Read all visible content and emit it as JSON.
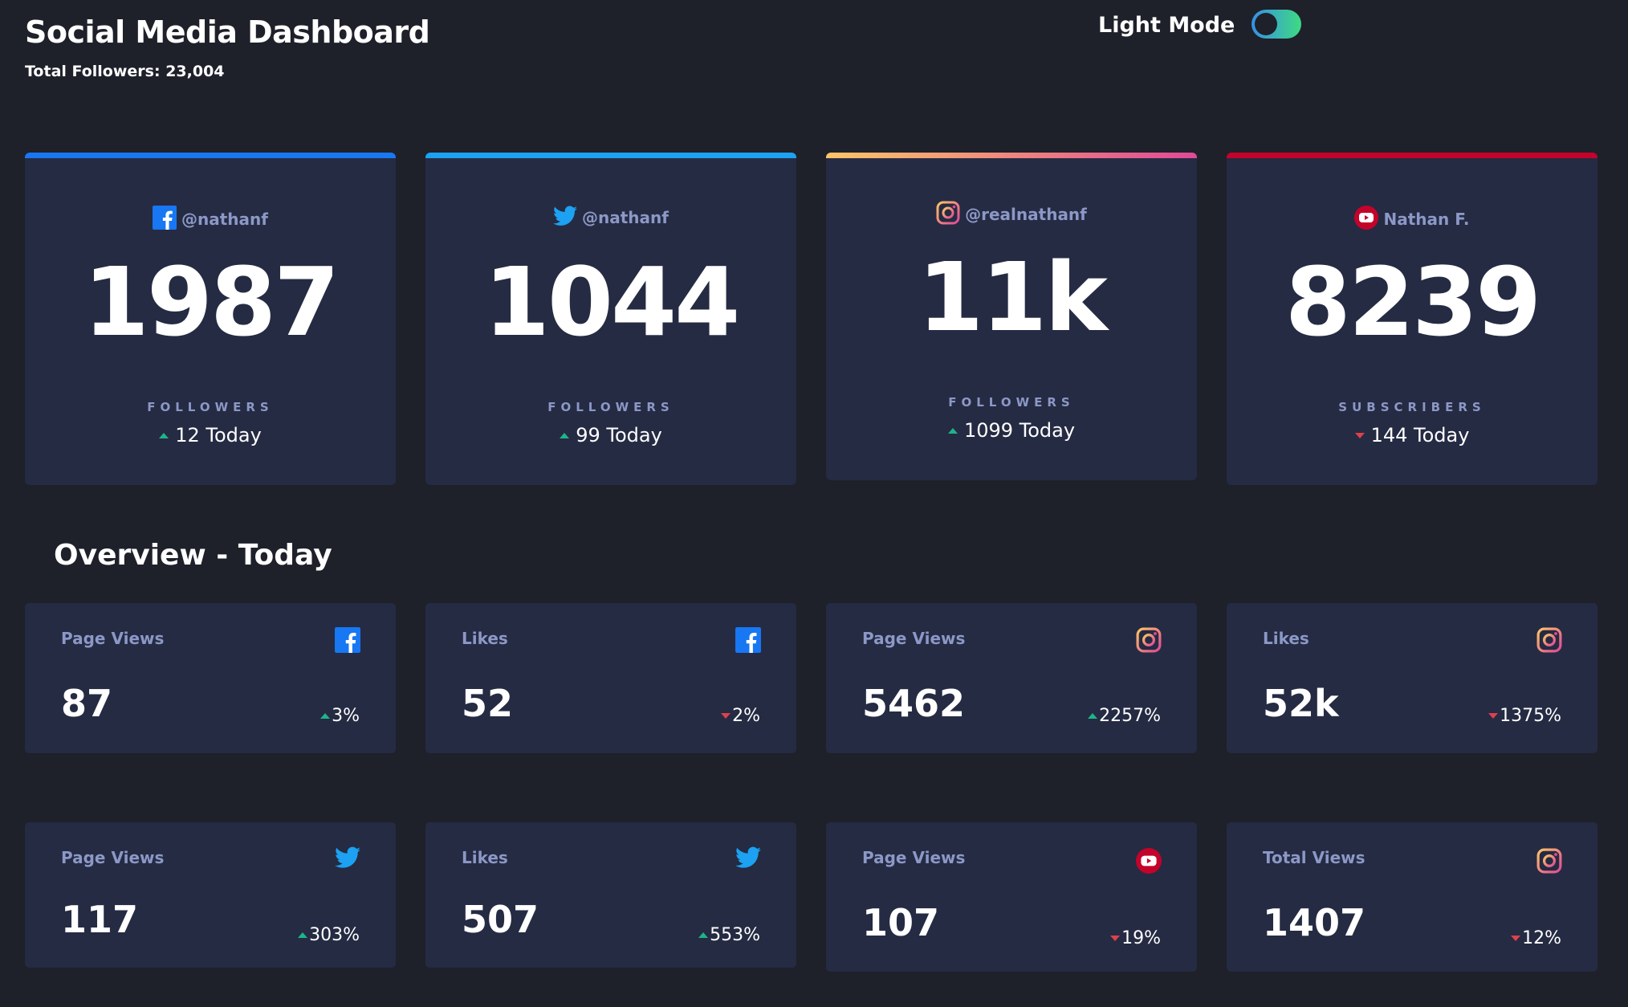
{
  "header": {
    "title": "Social Media Dashboard",
    "total_followers": "Total Followers: 23,004",
    "mode_label": "Light Mode"
  },
  "colors": {
    "facebook": "#1877f2",
    "twitter": "#1da1f2",
    "instagram_start": "#fdc468",
    "instagram_end": "#df4996",
    "youtube": "#c4032a",
    "up": "#1db489",
    "down": "#dc414c",
    "card_bg": "#252b43",
    "page_bg": "#1e202a"
  },
  "followers": [
    {
      "platform": "facebook",
      "icon": "facebook-icon",
      "handle": "@nathanf",
      "count": "1987",
      "unit": "FOLLOWERS",
      "today": "12 Today",
      "trend": "up"
    },
    {
      "platform": "twitter",
      "icon": "twitter-icon",
      "handle": "@nathanf",
      "count": "1044",
      "unit": "FOLLOWERS",
      "today": "99 Today",
      "trend": "up"
    },
    {
      "platform": "instagram",
      "icon": "instagram-icon",
      "handle": "@realnathanf",
      "count": "11k",
      "unit": "FOLLOWERS",
      "today": "1099 Today",
      "trend": "up"
    },
    {
      "platform": "youtube",
      "icon": "youtube-icon",
      "handle": "Nathan F.",
      "count": "8239",
      "unit": "SUBSCRIBERS",
      "today": "144 Today",
      "trend": "down"
    }
  ],
  "overview": {
    "title": "Overview - Today",
    "cards": [
      {
        "label": "Page Views",
        "icon": "facebook-icon",
        "value": "87",
        "pct": "3%",
        "trend": "up"
      },
      {
        "label": "Likes",
        "icon": "facebook-icon",
        "value": "52",
        "pct": "2%",
        "trend": "down"
      },
      {
        "label": "Page Views",
        "icon": "instagram-icon",
        "value": "5462",
        "pct": "2257%",
        "trend": "up"
      },
      {
        "label": "Likes",
        "icon": "instagram-icon",
        "value": "52k",
        "pct": "1375%",
        "trend": "down"
      },
      {
        "label": "Page Views",
        "icon": "twitter-icon",
        "value": "117",
        "pct": "303%",
        "trend": "up"
      },
      {
        "label": "Likes",
        "icon": "twitter-icon",
        "value": "507",
        "pct": "553%",
        "trend": "up"
      },
      {
        "label": "Page Views",
        "icon": "youtube-icon",
        "value": "107",
        "pct": "19%",
        "trend": "down"
      },
      {
        "label": "Total Views",
        "icon": "instagram-icon",
        "value": "1407",
        "pct": "12%",
        "trend": "down"
      }
    ]
  }
}
